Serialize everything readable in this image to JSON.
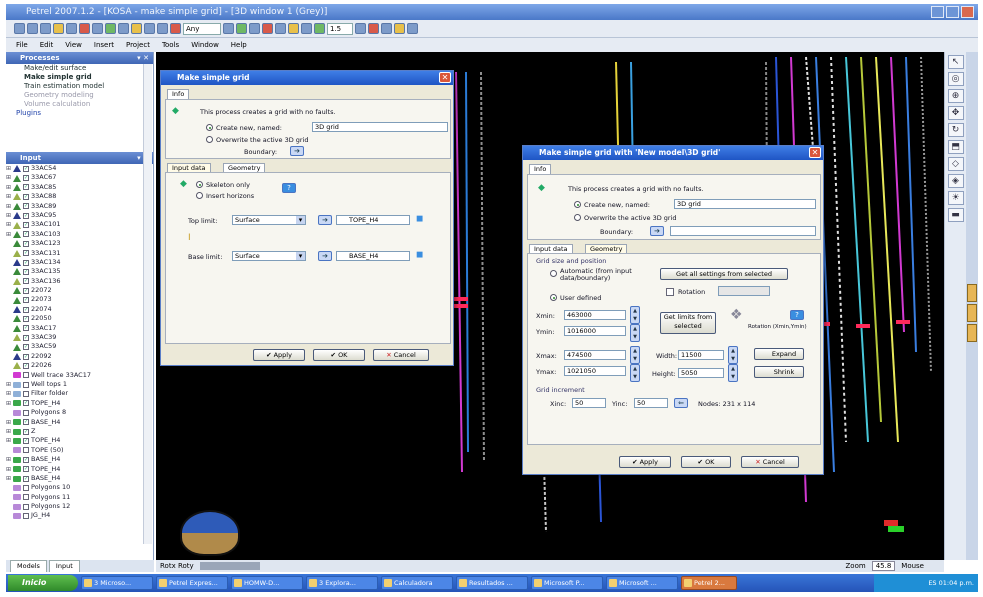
{
  "window": {
    "title": "Petrel 2007.1.2 - [KOSA - make simple grid] - [3D window 1 (Grey)]"
  },
  "toolbar": {
    "combo": "Any",
    "zoom_value": "1.5"
  },
  "menu": [
    "File",
    "Edit",
    "View",
    "Insert",
    "Project",
    "Tools",
    "Window",
    "Help"
  ],
  "processes": {
    "header": "Processes",
    "items": [
      "Make/edit surface",
      "Make simple grid",
      "Train estimation model",
      "Geometry modeling",
      "Volume calculation"
    ],
    "plugins": "Plugins"
  },
  "input": {
    "header": "Input",
    "tree": [
      {
        "label": "33AC54",
        "kind": "well"
      },
      {
        "label": "33AC67",
        "kind": "well"
      },
      {
        "label": "33AC85",
        "kind": "well"
      },
      {
        "label": "33AC88",
        "kind": "well"
      },
      {
        "label": "33AC89",
        "kind": "well"
      },
      {
        "label": "33AC95",
        "kind": "well"
      },
      {
        "label": "33AC101",
        "kind": "well"
      },
      {
        "label": "33AC103",
        "kind": "well"
      },
      {
        "label": "33AC123",
        "kind": "well"
      },
      {
        "label": "33AC131",
        "kind": "well"
      },
      {
        "label": "33AC134",
        "kind": "well"
      },
      {
        "label": "33AC135",
        "kind": "well"
      },
      {
        "label": "33AC136",
        "kind": "well"
      },
      {
        "label": "22072",
        "kind": "well"
      },
      {
        "label": "22073",
        "kind": "well"
      },
      {
        "label": "22074",
        "kind": "well"
      },
      {
        "label": "22050",
        "kind": "well"
      },
      {
        "label": "33AC17",
        "kind": "well"
      },
      {
        "label": "33AC39",
        "kind": "well"
      },
      {
        "label": "33AC59",
        "kind": "well"
      },
      {
        "label": "22092",
        "kind": "well"
      },
      {
        "label": "22026",
        "kind": "well"
      },
      {
        "label": "Well trace 33AC17",
        "kind": "trace"
      },
      {
        "label": "Well tops 1",
        "kind": "folder"
      },
      {
        "label": "Filter folder",
        "kind": "folder"
      },
      {
        "label": "TOPE_H4",
        "kind": "surface"
      },
      {
        "label": "Polygons 8",
        "kind": "poly"
      },
      {
        "label": "BASE_H4",
        "kind": "surface"
      },
      {
        "label": "Z",
        "kind": "surface"
      },
      {
        "label": "TOPE_H4",
        "kind": "surface"
      },
      {
        "label": "TOPE (50)",
        "kind": "poly"
      },
      {
        "label": "BASE_H4",
        "kind": "surface"
      },
      {
        "label": "TOPE_H4",
        "kind": "surface"
      },
      {
        "label": "BASE_H4",
        "kind": "surface"
      },
      {
        "label": "Polygons 10",
        "kind": "poly"
      },
      {
        "label": "Polygons 11",
        "kind": "poly"
      },
      {
        "label": "Polygons 12",
        "kind": "poly"
      },
      {
        "label": "JG_H4",
        "kind": "poly"
      }
    ],
    "tabs": [
      "Models",
      "Input"
    ]
  },
  "dialog1": {
    "title": "Make simple grid",
    "tab_info": "Info",
    "intro": "This process creates a grid with no faults.",
    "create_new_label": "Create new, named:",
    "create_new_value": "3D grid",
    "overwrite_label": "Overwrite the active 3D grid",
    "boundary_label": "Boundary:",
    "tabs": [
      "Input data",
      "Geometry"
    ],
    "skeleton_only": "Skeleton only",
    "insert_horizons": "Insert horizons",
    "top_limit_label": "Top limit:",
    "top_limit_type": "Surface",
    "top_limit_value": "TOPE_H4",
    "base_limit_label": "Base limit:",
    "base_limit_type": "Surface",
    "base_limit_value": "BASE_H4",
    "apply": "Apply",
    "ok": "OK",
    "cancel": "Cancel"
  },
  "dialog2": {
    "title": "Make simple grid with 'New model\\3D grid'",
    "tab_info": "Info",
    "intro": "This process creates a grid with no faults.",
    "create_new_label": "Create new, named:",
    "create_new_value": "3D grid",
    "overwrite_label": "Overwrite the active 3D grid",
    "boundary_label": "Boundary:",
    "tabs": [
      "Input data",
      "Geometry"
    ],
    "group_label": "Grid size and position",
    "automatic": "Automatic (from input data/boundary)",
    "user_defined": "User defined",
    "get_all": "Get all settings from selected",
    "rotation_label": "Rotation",
    "xmin_label": "Xmin:",
    "xmin": "463000",
    "ymin_label": "Ymin:",
    "ymin": "1016000",
    "xmax_label": "Xmax:",
    "xmax": "474500",
    "ymax_label": "Ymax:",
    "ymax": "1021050",
    "get_limits": "Get limits from selected",
    "rotation_caption": "Rotation (Xmin,Ymin)",
    "width_label": "Width:",
    "width": "11500",
    "height_label": "Height:",
    "height": "5050",
    "expand": "Expand",
    "shrink": "Shrink",
    "inc_label": "Grid increment",
    "xinc_label": "Xinc:",
    "xinc": "50",
    "yinc_label": "Yinc:",
    "yinc": "50",
    "nodes": "Nodes: 231 x 114",
    "apply": "Apply",
    "ok": "OK",
    "cancel": "Cancel"
  },
  "viewport_status": {
    "left": "Rotx  Roty",
    "zoom_label": "Zoom",
    "zoom": "45.8",
    "mode": "Mouse"
  },
  "taskbar": {
    "start": "Inicio",
    "tasks": [
      "3 Microso...",
      "Petrel Expres...",
      "HOMW-D...",
      "3 Explora...",
      "Calculadora",
      "Resultados ...",
      "Microsoft P...",
      "Microsoft ...",
      "Petrel 2..."
    ],
    "tray": "ES  01:04 p.m."
  }
}
